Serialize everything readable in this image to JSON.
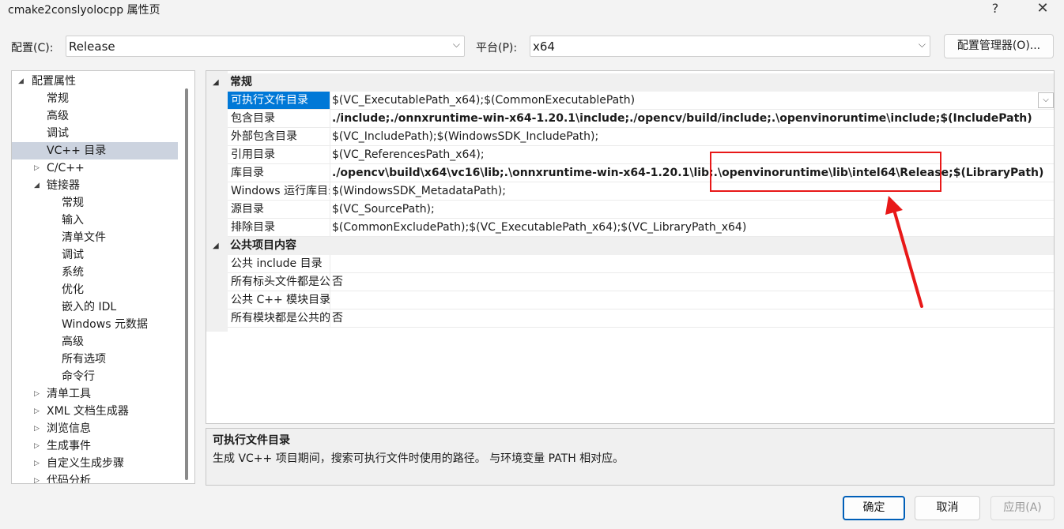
{
  "window": {
    "title": "cmake2conslyolocpp 属性页",
    "help_label": "?",
    "close_label": "✕"
  },
  "config": {
    "label": "配置(C):",
    "value": "Release",
    "platform_label": "平台(P):",
    "platform_value": "x64",
    "manager_button": "配置管理器(O)..."
  },
  "tree": {
    "items": [
      {
        "label": "配置属性",
        "expander": "◢"
      },
      {
        "label": "常规",
        "expander": ""
      },
      {
        "label": "高级",
        "expander": ""
      },
      {
        "label": "调试",
        "expander": ""
      },
      {
        "label": "VC++ 目录",
        "expander": "",
        "selected": true
      },
      {
        "label": "C/C++",
        "expander": "▷"
      },
      {
        "label": "链接器",
        "expander": "◢"
      },
      {
        "label": "常规",
        "expander": ""
      },
      {
        "label": "输入",
        "expander": ""
      },
      {
        "label": "清单文件",
        "expander": ""
      },
      {
        "label": "调试",
        "expander": ""
      },
      {
        "label": "系统",
        "expander": ""
      },
      {
        "label": "优化",
        "expander": ""
      },
      {
        "label": "嵌入的 IDL",
        "expander": ""
      },
      {
        "label": "Windows 元数据",
        "expander": ""
      },
      {
        "label": "高级",
        "expander": ""
      },
      {
        "label": "所有选项",
        "expander": ""
      },
      {
        "label": "命令行",
        "expander": ""
      },
      {
        "label": "清单工具",
        "expander": "▷"
      },
      {
        "label": "XML 文档生成器",
        "expander": "▷"
      },
      {
        "label": "浏览信息",
        "expander": "▷"
      },
      {
        "label": "生成事件",
        "expander": "▷"
      },
      {
        "label": "自定义生成步骤",
        "expander": "▷"
      },
      {
        "label": "代码分析",
        "expander": "▷"
      }
    ]
  },
  "grid": {
    "categories": [
      {
        "label": "常规",
        "expander": "◢"
      },
      {
        "label": "公共项目内容",
        "expander": "◢"
      }
    ],
    "general_rows": [
      {
        "name": "可执行文件目录",
        "value": "$(VC_ExecutablePath_x64);$(CommonExecutablePath)",
        "bold": false,
        "selected": true
      },
      {
        "name": "包含目录",
        "value": "./include;./onnxruntime-win-x64-1.20.1\\include;./opencv/build/include;.\\openvinoruntime\\include;$(IncludePath)",
        "bold": true
      },
      {
        "name": "外部包含目录",
        "value": "$(VC_IncludePath);$(WindowsSDK_IncludePath);",
        "bold": false
      },
      {
        "name": "引用目录",
        "value": "$(VC_ReferencesPath_x64);",
        "bold": false
      },
      {
        "name": "库目录",
        "value": "./opencv\\build\\x64\\vc16\\lib;.\\onnxruntime-win-x64-1.20.1\\lib;.\\openvinoruntime\\lib\\intel64\\Release;$(LibraryPath)",
        "bold": true
      },
      {
        "name": "Windows 运行库目录",
        "value": "$(WindowsSDK_MetadataPath);",
        "bold": false
      },
      {
        "name": "源目录",
        "value": "$(VC_SourcePath);",
        "bold": false
      },
      {
        "name": "排除目录",
        "value": "$(CommonExcludePath);$(VC_ExecutablePath_x64);$(VC_LibraryPath_x64)",
        "bold": false
      }
    ],
    "public_rows": [
      {
        "name": "公共 include 目录",
        "value": ""
      },
      {
        "name": "所有标头文件都是公共的",
        "value": "否"
      },
      {
        "name": "公共 C++ 模块目录",
        "value": ""
      },
      {
        "name": "所有模块都是公共的",
        "value": "否"
      }
    ],
    "dropdown_glyph": "⌵"
  },
  "description": {
    "title": "可执行文件目录",
    "text": "生成 VC++ 项目期间，搜索可执行文件时使用的路径。 与环境变量 PATH 相对应。"
  },
  "buttons": {
    "ok": "确定",
    "cancel": "取消",
    "apply": "应用(A)"
  },
  "colors": {
    "selection": "#0078d7",
    "highlight": "#e81818"
  }
}
